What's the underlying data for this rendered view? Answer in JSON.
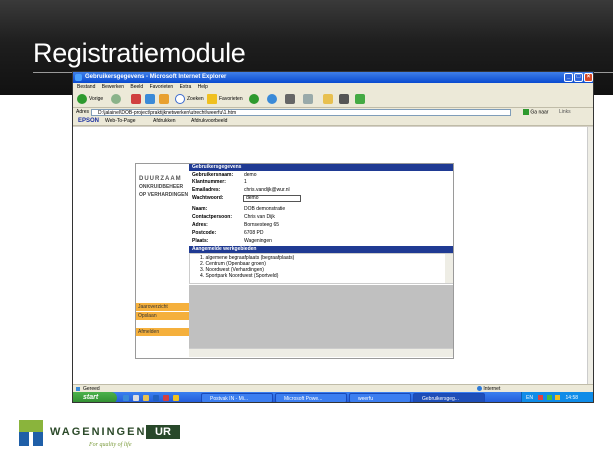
{
  "slide": {
    "title": "Registratiemodule"
  },
  "ie": {
    "window_title": "Gebruikersgegevens - Microsoft Internet Explorer",
    "menu": [
      "Bestand",
      "Bewerken",
      "Beeld",
      "Favorieten",
      "Extra",
      "Help"
    ],
    "toolbar": {
      "back": "Vorige",
      "search": "Zoeken",
      "favorites": "Favorieten"
    },
    "address_label": "Adres",
    "address_value": "D:\\jalainel\\DOB-project\\praktijknetwerken\\utrecht\\weerfu\\1.htm",
    "go_label": "Ga naar",
    "links_label": "Links",
    "epson": {
      "brand": "EPSON",
      "webtopage": "Web-To-Page",
      "print": "Afdrukken",
      "preview": "Afdrukvoorbeeld"
    },
    "status_left": "Gereed",
    "status_zone": "Internet"
  },
  "app": {
    "logo_lines": [
      "DUURZAAM",
      "ONKRUIDBEHEER",
      "OP VERHARDINGEN"
    ],
    "side_links": [
      "Jaaroverzicht",
      "Opslaan",
      "Afmelden"
    ],
    "section_user": "Gebruikersgegevens",
    "fields": [
      {
        "label": "Gebruikersnaam:",
        "value": "demo"
      },
      {
        "label": "Klantnummer:",
        "value": "1"
      },
      {
        "label": "Emailadres:",
        "value": "chris.vandijk@wur.nl"
      },
      {
        "label": "Wachtwoord:",
        "value": "demo"
      },
      {
        "label": "Naam:",
        "value": "DOB demonstratie"
      },
      {
        "label": "Contactpersoon:",
        "value": "Chris van Dijk"
      },
      {
        "label": "Adres:",
        "value": "Bornsesteeg 65"
      },
      {
        "label": "Postcode:",
        "value": "6708 PD"
      },
      {
        "label": "Plaats:",
        "value": "Wageningen"
      }
    ],
    "section_areas": "Aangemelde werkgebieden",
    "areas": [
      "1. algemene begraafplaats (begraafplaats)",
      "2. Centrum (Openbaar groen)",
      "3. Noordwest (Verhardingen)",
      "4. Sportpark Noordwest (Sportveld)"
    ]
  },
  "taskbar": {
    "start": "start",
    "tasks": [
      "Postvak IN - Mi...",
      "Microsoft Powe...",
      "weerfu",
      "Gebruikersgeg..."
    ],
    "tray_lang": "EN",
    "clock": "14:58"
  },
  "footer": {
    "org_name": "WAGENINGEN",
    "org_ur": "UR",
    "tagline": "For quality of life"
  },
  "colors": {
    "section_blue": "#1f3a93",
    "side_orange": "#f5b03c",
    "wur_green": "#28482a"
  }
}
